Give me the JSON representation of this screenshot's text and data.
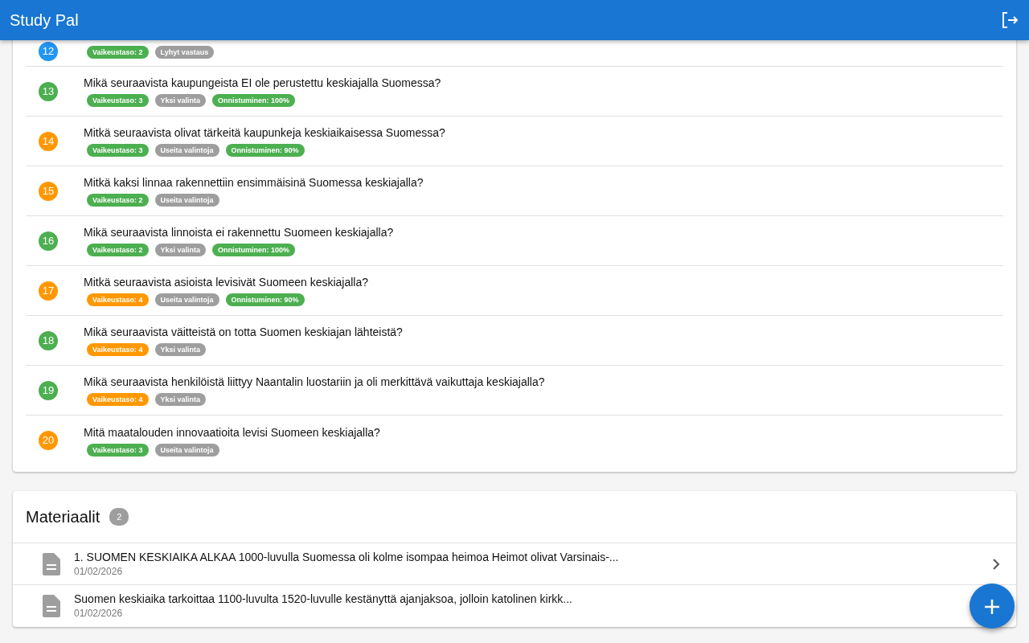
{
  "app_bar": {
    "title": "Study Pal"
  },
  "questions": [
    {
      "number": "12",
      "color": "#2196f3",
      "badges": [
        {
          "text": "Vaikeustaso: 2",
          "color": "#4caf50"
        },
        {
          "text": "Lyhyt vastaus",
          "color": "#9e9e9e"
        }
      ]
    },
    {
      "number": "13",
      "color": "#4caf50",
      "question": "Mikä seuraavista kaupungeista EI ole perustettu keskiajalla Suomessa?",
      "badges": [
        {
          "text": "Vaikeustaso: 3",
          "color": "#4caf50"
        },
        {
          "text": "Yksi valinta",
          "color": "#9e9e9e"
        },
        {
          "text": "Onnistuminen: 100%",
          "color": "#4caf50"
        }
      ]
    },
    {
      "number": "14",
      "color": "#ff9800",
      "question": "Mitkä seuraavista olivat tärkeitä kaupunkeja keskiaikaisessa Suomessa?",
      "badges": [
        {
          "text": "Vaikeustaso: 3",
          "color": "#4caf50"
        },
        {
          "text": "Useita valintoja",
          "color": "#9e9e9e"
        },
        {
          "text": "Onnistuminen: 90%",
          "color": "#4caf50"
        }
      ]
    },
    {
      "number": "15",
      "color": "#ff9800",
      "question": "Mitkä kaksi linnaa rakennettiin ensimmäisinä Suomessa keskiajalla?",
      "badges": [
        {
          "text": "Vaikeustaso: 2",
          "color": "#4caf50"
        },
        {
          "text": "Useita valintoja",
          "color": "#9e9e9e"
        }
      ]
    },
    {
      "number": "16",
      "color": "#4caf50",
      "question": "Mikä seuraavista linnoista ei rakennettu Suomeen keskiajalla?",
      "badges": [
        {
          "text": "Vaikeustaso: 2",
          "color": "#4caf50"
        },
        {
          "text": "Yksi valinta",
          "color": "#9e9e9e"
        },
        {
          "text": "Onnistuminen: 100%",
          "color": "#4caf50"
        }
      ]
    },
    {
      "number": "17",
      "color": "#ff9800",
      "question": "Mitkä seuraavista asioista levisivät Suomeen keskiajalla?",
      "badges": [
        {
          "text": "Vaikeustaso: 4",
          "color": "#ff9800"
        },
        {
          "text": "Useita valintoja",
          "color": "#9e9e9e"
        },
        {
          "text": "Onnistuminen: 90%",
          "color": "#4caf50"
        }
      ]
    },
    {
      "number": "18",
      "color": "#4caf50",
      "question": "Mikä seuraavista väitteistä on totta Suomen keskiajan lähteistä?",
      "badges": [
        {
          "text": "Vaikeustaso: 4",
          "color": "#ff9800"
        },
        {
          "text": "Yksi valinta",
          "color": "#9e9e9e"
        }
      ]
    },
    {
      "number": "19",
      "color": "#4caf50",
      "question": "Mikä seuraavista henkilöistä liittyy Naantalin luostariin ja oli merkittävä vaikuttaja keskiajalla?",
      "badges": [
        {
          "text": "Vaikeustaso: 4",
          "color": "#ff9800"
        },
        {
          "text": "Yksi valinta",
          "color": "#9e9e9e"
        }
      ]
    },
    {
      "number": "20",
      "color": "#ff9800",
      "question": "Mitä maatalouden innovaatioita levisi Suomeen keskiajalla?",
      "badges": [
        {
          "text": "Vaikeustaso: 3",
          "color": "#4caf50"
        },
        {
          "text": "Useita valintoja",
          "color": "#9e9e9e"
        }
      ]
    }
  ],
  "materials": {
    "title": "Materiaalit",
    "count": "2",
    "items": [
      {
        "text": "1. SUOMEN KESKIAIKA ALKAA 1000-luvulla Suomessa oli kolme isompaa heimoa Heimot olivat Varsinais-...",
        "date": "01/02/2026",
        "chevron": true
      },
      {
        "text": "Suomen keskiaika tarkoittaa 1100-luvulta 1520-luvulle kestänyttä ajanjaksoa, jolloin katolinen kirkk...",
        "date": "01/02/2026",
        "chevron": false
      }
    ]
  }
}
